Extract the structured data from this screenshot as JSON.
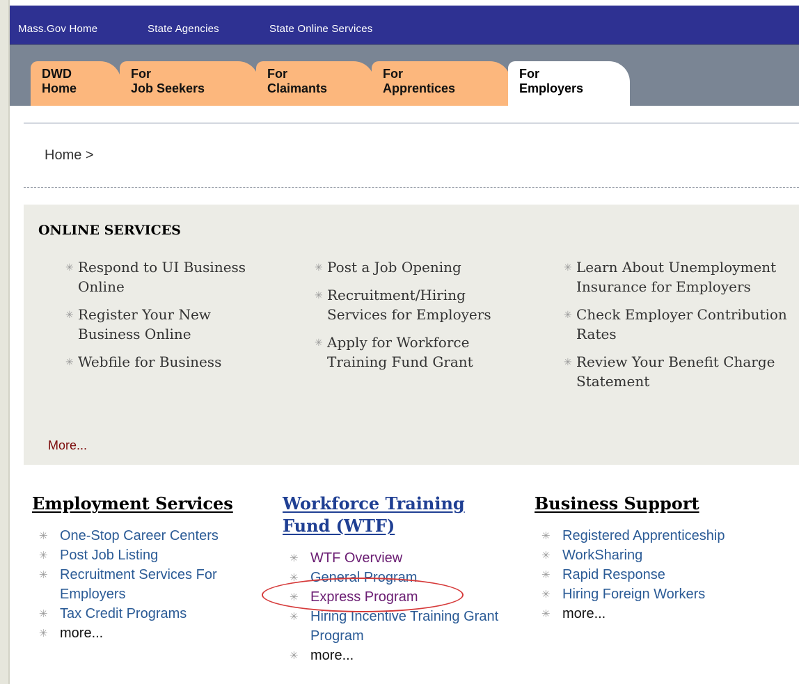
{
  "topnav": [
    "Mass.Gov Home",
    "State Agencies",
    "State Online Services"
  ],
  "tabs": [
    {
      "lines": [
        "DWD",
        "Home"
      ]
    },
    {
      "lines": [
        "For",
        "Job Seekers"
      ]
    },
    {
      "lines": [
        "For",
        "Claimants"
      ]
    },
    {
      "lines": [
        "For",
        "Apprentices"
      ]
    },
    {
      "lines": [
        "For",
        "Employers"
      ]
    }
  ],
  "breadcrumb": "Home >",
  "online_services": {
    "title": "ONLINE SERVICES",
    "columns": [
      [
        "Respond to UI Business Online",
        "Register Your New Business Online",
        "Webfile for Business"
      ],
      [
        "Post a Job Opening",
        "Recruitment/Hiring Services for Employers",
        "Apply for Workforce Training Fund Grant"
      ],
      [
        "Learn About Unemployment Insurance for Employers",
        "Check Employer Contribution Rates",
        "Review Your Benefit Charge Statement"
      ]
    ],
    "more": "More..."
  },
  "sections": [
    {
      "title": "Employment Services",
      "items": [
        "One-Stop Career Centers",
        "Post Job Listing",
        "Recruitment Services For Employers",
        "Tax Credit Programs",
        "more..."
      ]
    },
    {
      "title": "Workforce Training Fund (WTF)",
      "items": [
        "WTF Overview",
        "General Program",
        "Express Program",
        "Hiring Incentive Training Grant Program",
        "more..."
      ]
    },
    {
      "title": "Business Support",
      "items": [
        "Registered Apprenticeship",
        "WorkSharing",
        "Rapid Response",
        "Hiring Foreign Workers",
        "more..."
      ]
    }
  ],
  "colors": {
    "topbar": "#2e3192",
    "tab": "#fcb77d",
    "tabbar": "#7a8594",
    "link": "#2b5b96",
    "visited": "#6b1e73",
    "highlight": "#d63b3b"
  }
}
